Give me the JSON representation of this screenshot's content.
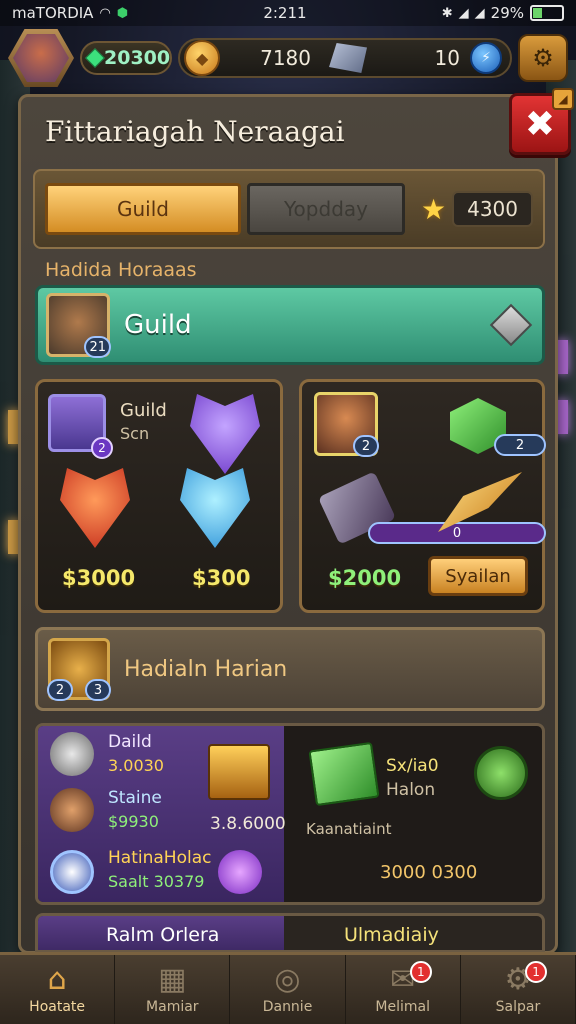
{
  "status_bar": {
    "carrier": "maTORDIA",
    "time": "2:211",
    "battery": "29%"
  },
  "resources": {
    "gems": "20300",
    "gold": "7180",
    "ore": "10"
  },
  "dialog": {
    "title": "Fittariagah Neraagai",
    "tabs": [
      {
        "label": "Guild",
        "active": true
      },
      {
        "label": "Yopdday",
        "active": false
      }
    ],
    "stars": "4300",
    "section_heading": "Hadida Horaaas",
    "guild_banner": {
      "label": "Guild",
      "level": "21"
    },
    "card_left": {
      "title": "Guild",
      "subtitle": "Scn",
      "badge": "2",
      "price_left": "$3000",
      "price_right": "$300"
    },
    "card_right": {
      "portrait_badge": "2",
      "cube_badge": "2",
      "scroll_badge": "0",
      "price": "$2000",
      "buy_label": "Syailan"
    },
    "daily": {
      "label": "Hadialn Harian",
      "badge_a": "2",
      "badge_b": "3"
    },
    "list": {
      "rows": [
        {
          "title": "Daild",
          "value": "3.0030"
        },
        {
          "title": "Staine",
          "value": "$9930"
        },
        {
          "title": "HatinaHolac",
          "value": "Saalt 30379"
        }
      ],
      "chest_value": "3.8.6000",
      "right_title": "Sx/ia0",
      "right_sub": "Halon",
      "right_label": "Kaanatiaint",
      "right_value": "3000 0300"
    },
    "partial_row": {
      "left": "Ralm Orlera",
      "right": "Ulmadiaiy"
    }
  },
  "bottom_nav": [
    {
      "label": "Hoatate",
      "icon": "home-icon",
      "active": true,
      "badge": ""
    },
    {
      "label": "Mamiar",
      "icon": "map-icon",
      "active": false,
      "badge": ""
    },
    {
      "label": "Dannie",
      "icon": "compass-icon",
      "active": false,
      "badge": ""
    },
    {
      "label": "Melimal",
      "icon": "mail-icon",
      "active": false,
      "badge": "1"
    },
    {
      "label": "Salpar",
      "icon": "settings-icon",
      "active": false,
      "badge": "1"
    }
  ]
}
